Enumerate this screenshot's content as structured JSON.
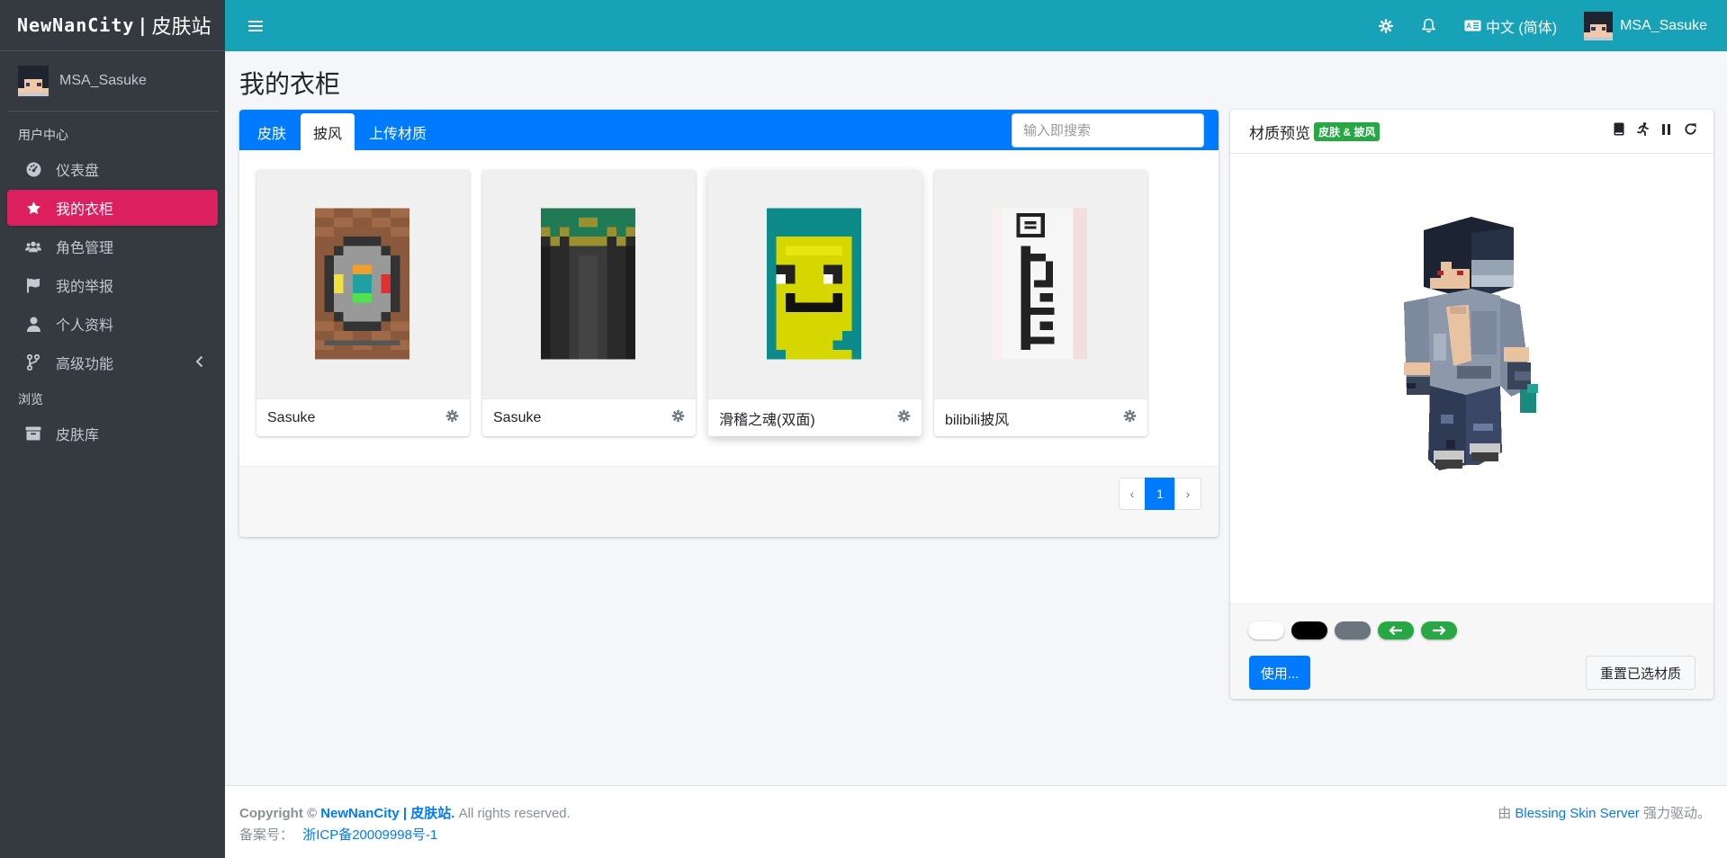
{
  "brand": {
    "name": "NewNanCity",
    "separator": "|",
    "suffix": "皮肤站"
  },
  "user": {
    "name": "MSA_Sasuke"
  },
  "sidebar": {
    "sections": [
      {
        "header": "用户中心"
      },
      {
        "header": "浏览"
      }
    ],
    "items": [
      {
        "label": "仪表盘",
        "icon": "dashboard-icon"
      },
      {
        "label": "我的衣柜",
        "icon": "star-icon",
        "active": true
      },
      {
        "label": "角色管理",
        "icon": "users-icon"
      },
      {
        "label": "我的举报",
        "icon": "flag-icon"
      },
      {
        "label": "个人资料",
        "icon": "user-icon"
      },
      {
        "label": "高级功能",
        "icon": "branch-icon"
      },
      {
        "label": "皮肤库",
        "icon": "archive-icon"
      }
    ]
  },
  "topbar": {
    "language": "中文 (简体)",
    "user": "MSA_Sasuke"
  },
  "page": {
    "title": "我的衣柜"
  },
  "wardrobe": {
    "tabs": [
      "皮肤",
      "披风",
      "上传材质"
    ],
    "active_tab": "披风",
    "search_placeholder": "输入即搜索",
    "items": [
      {
        "name": "Sasuke"
      },
      {
        "name": "Sasuke"
      },
      {
        "name": "滑稽之魂(双面)"
      },
      {
        "name": "bilibili披风"
      }
    ],
    "pagination": {
      "prev": "‹",
      "current": "1",
      "next": "›"
    }
  },
  "preview": {
    "title": "材质预览",
    "badge": "皮肤 & 披风",
    "use_button": "使用...",
    "reset_button": "重置已选材质",
    "colors": {
      "white": "#ffffff",
      "black": "#000000",
      "gray": "#6c757d",
      "green": "#28a745"
    }
  },
  "footer": {
    "copyright_prefix": "Copyright ©",
    "site_link": "NewNanCity | 皮肤站.",
    "rights": "All rights reserved.",
    "icp_label": "备案号：",
    "icp_number": "浙ICP备20009998号-1",
    "powered_prefix": "由",
    "powered_link": "Blessing Skin Server",
    "powered_suffix": "强力驱动。"
  }
}
